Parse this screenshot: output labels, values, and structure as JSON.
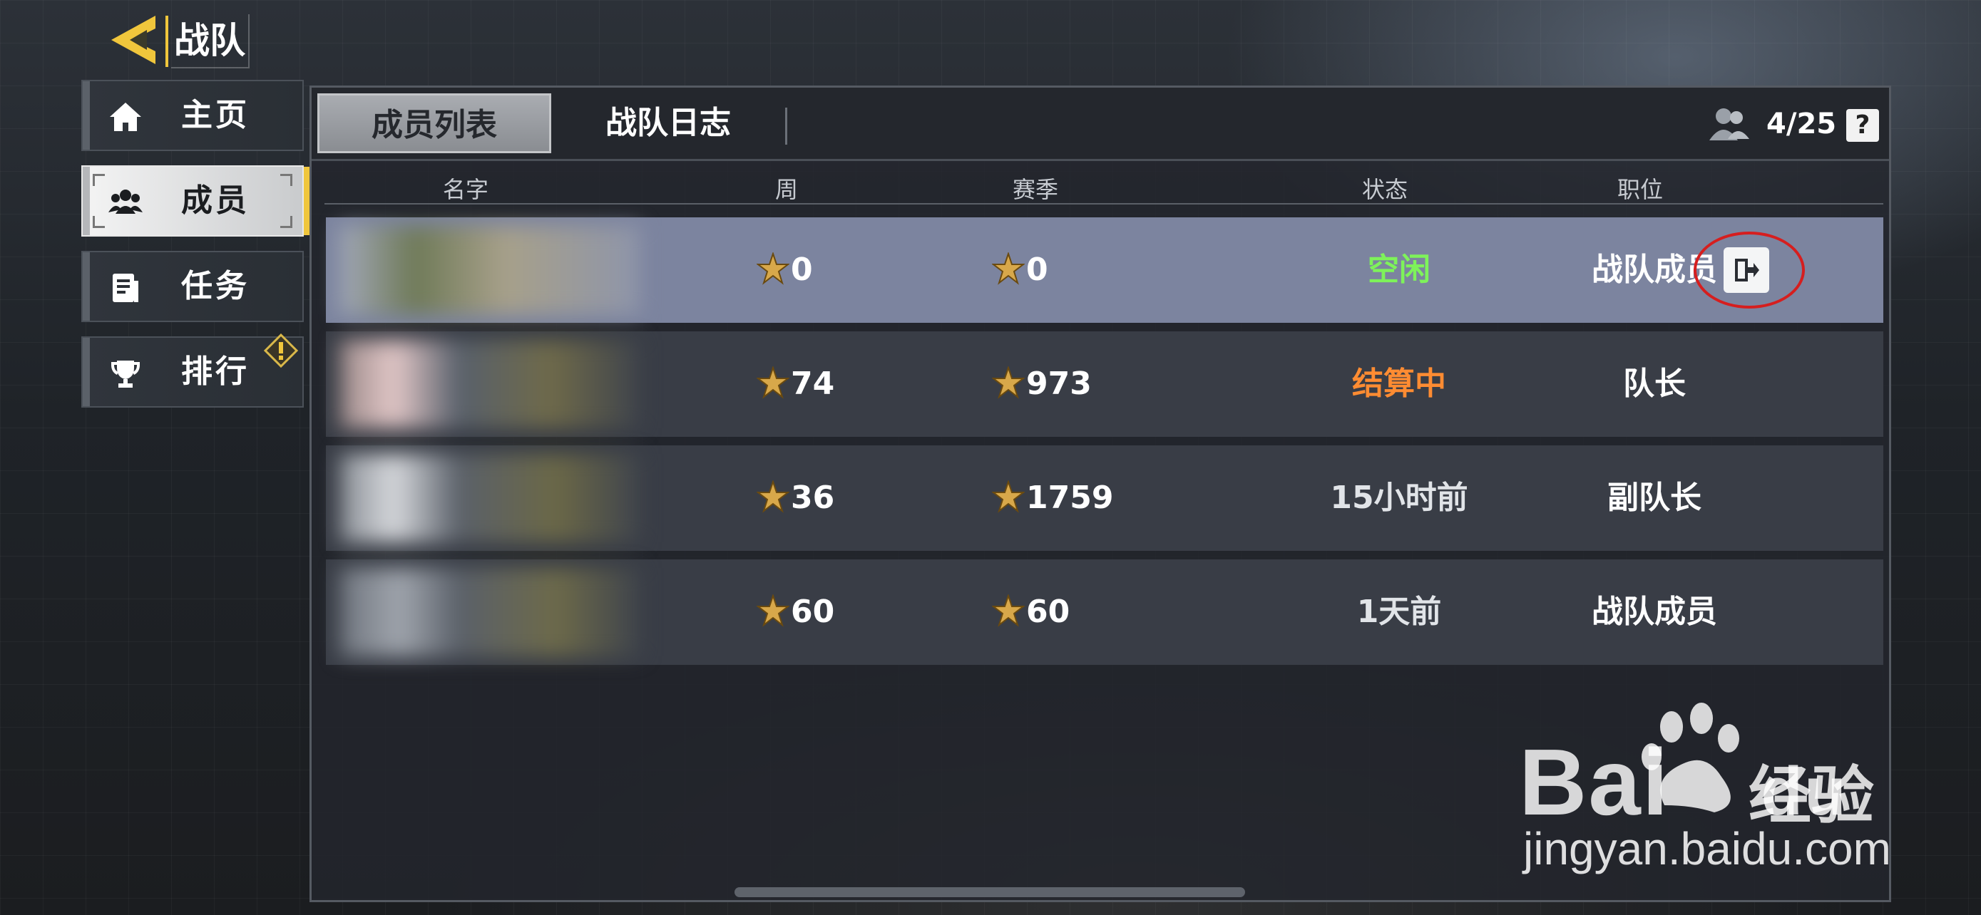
{
  "header": {
    "title": "战队"
  },
  "sidebar": {
    "items": [
      {
        "label": "主页",
        "icon": "home-icon",
        "active": false
      },
      {
        "label": "成员",
        "icon": "members-icon",
        "active": true
      },
      {
        "label": "任务",
        "icon": "task-icon",
        "active": false
      },
      {
        "label": "排行",
        "icon": "trophy-icon",
        "active": false,
        "badge": "warning-icon"
      }
    ]
  },
  "tabs": [
    {
      "label": "成员列表",
      "active": true
    },
    {
      "label": "战队日志",
      "active": false
    }
  ],
  "member_count": "4/25",
  "help_label": "?",
  "columns": {
    "name": "名字",
    "week": "周",
    "season": "赛季",
    "status": "状态",
    "role": "职位"
  },
  "members": [
    {
      "week": "0",
      "season": "0",
      "status": "空闲",
      "status_color": "#7ef25a",
      "role": "战队成员",
      "selected": true
    },
    {
      "week": "74",
      "season": "973",
      "status": "结算中",
      "status_color": "#ff8c32",
      "role": "队长",
      "selected": false
    },
    {
      "week": "36",
      "season": "1759",
      "status": "15小时前",
      "status_color": "#e1e4e8",
      "role": "副队长",
      "selected": false
    },
    {
      "week": "60",
      "season": "60",
      "status": "1天前",
      "status_color": "#e1e4e8",
      "role": "战队成员",
      "selected": false
    }
  ],
  "colors": {
    "accent": "#f0c63c",
    "selected_row": "#7c849f",
    "highlight_ring": "#d61e1e"
  },
  "watermark": {
    "logo_left": "Bai",
    "logo_right": "du",
    "cn": "经验",
    "url": "jingyan.baidu.com"
  }
}
